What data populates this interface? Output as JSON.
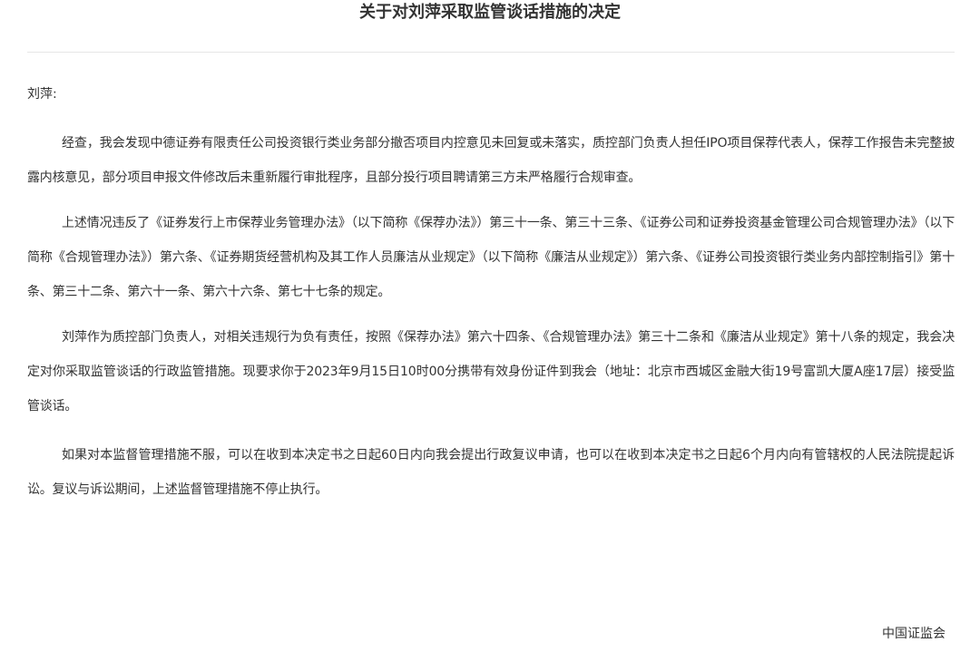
{
  "document": {
    "title": "关于对刘萍采取监管谈话措施的决定",
    "addressee": "刘萍:",
    "paragraphs": [
      "经查，我会发现中德证券有限责任公司投资银行类业务部分撤否项目内控意见未回复或未落实，质控部门负责人担任IPO项目保荐代表人，保荐工作报告未完整披露内核意见，部分项目申报文件修改后未重新履行审批程序，且部分投行项目聘请第三方未严格履行合规审查。",
      "上述情况违反了《证券发行上市保荐业务管理办法》（以下简称《保荐办法》）第三十一条、第三十三条、《证券公司和证券投资基金管理公司合规管理办法》（以下简称《合规管理办法》）第六条、《证券期货经营机构及其工作人员廉洁从业规定》（以下简称《廉洁从业规定》）第六条、《证券公司投资银行类业务内部控制指引》第十条、第三十二条、第六十一条、第六十六条、第七十七条的规定。",
      "刘萍作为质控部门负责人，对相关违规行为负有责任，按照《保荐办法》第六十四条、《合规管理办法》第三十二条和《廉洁从业规定》第十八条的规定，我会决定对你采取监管谈话的行政监管措施。现要求你于2023年9月15日10时00分携带有效身份证件到我会（地址：北京市西城区金融大街19号富凯大厦A座17层）接受监管谈话。",
      "如果对本监督管理措施不服，可以在收到本决定书之日起60日内向我会提出行政复议申请，也可以在收到本决定书之日起6个月内向有管辖权的人民法院提起诉讼。复议与诉讼期间，上述监督管理措施不停止执行。"
    ],
    "signature": "中国证监会"
  }
}
